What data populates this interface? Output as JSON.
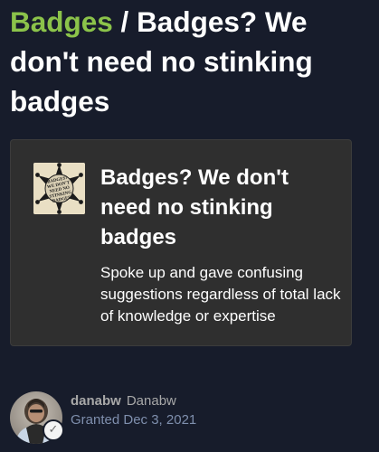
{
  "breadcrumb": {
    "parent_label": "Badges",
    "separator": " / ",
    "current_label": "Badges? We don't need no stinking badges"
  },
  "badge": {
    "name": "Badges? We don't need no stinking badges",
    "description": "Spoke up and gave confusing suggestions regardless of total lack of knowledge or expertise",
    "image_icon": "sheriff-star-badge-icon",
    "image_text": [
      "BADGES?",
      "WE DON'T",
      "NEED NO",
      "STINKING",
      "BADGES"
    ]
  },
  "grant": {
    "username": "danabw",
    "display_name": "Danabw",
    "granted_prefix": "Granted ",
    "granted_date": "Dec 3, 2021",
    "avatar_icon": "user-avatar-icon",
    "check_icon": "checkmark-icon"
  },
  "colors": {
    "background": "#171c2b",
    "accent": "#8bc34a",
    "card_background": "#2f2f2f",
    "muted_text": "#a8a8a8",
    "date_text": "#7f8fad"
  }
}
